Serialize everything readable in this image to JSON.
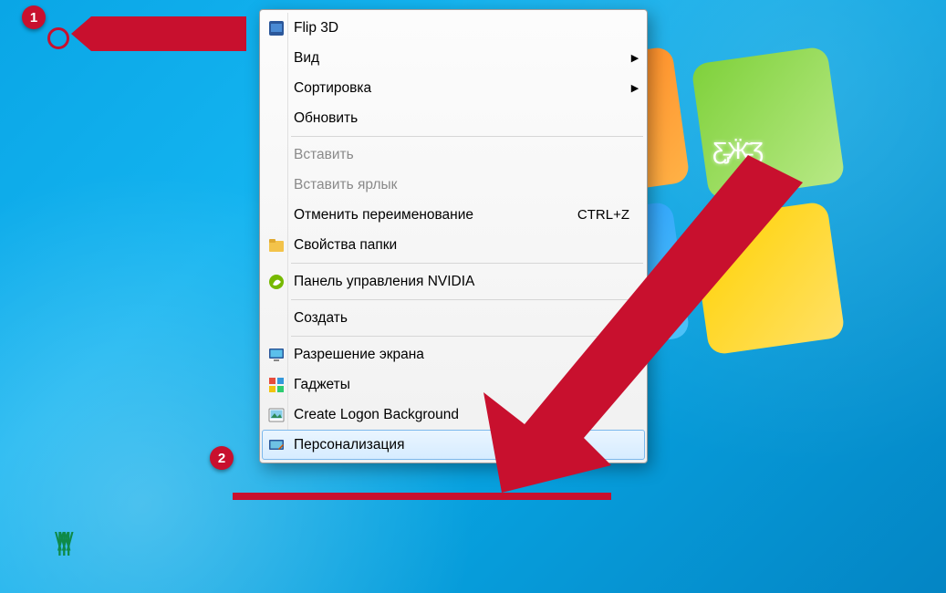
{
  "annotations": {
    "step1": "1",
    "step2": "2"
  },
  "menu": {
    "items": [
      {
        "id": "flip3d",
        "label": "Flip 3D",
        "icon": "flip3d-icon",
        "submenu": false
      },
      {
        "id": "view",
        "label": "Вид",
        "icon": null,
        "submenu": true
      },
      {
        "id": "sort",
        "label": "Сортировка",
        "icon": null,
        "submenu": true
      },
      {
        "id": "refresh",
        "label": "Обновить",
        "icon": null,
        "submenu": false
      },
      {
        "sep": true
      },
      {
        "id": "paste",
        "label": "Вставить",
        "icon": null,
        "disabled": true
      },
      {
        "id": "pastelnk",
        "label": "Вставить ярлык",
        "icon": null,
        "disabled": true
      },
      {
        "id": "undo",
        "label": "Отменить переименование",
        "icon": null,
        "shortcut": "CTRL+Z"
      },
      {
        "id": "folderopt",
        "label": "Свойства папки",
        "icon": "folder-options-icon"
      },
      {
        "sep": true
      },
      {
        "id": "nvidia",
        "label": "Панель управления NVIDIA",
        "icon": "nvidia-icon"
      },
      {
        "sep": true
      },
      {
        "id": "new",
        "label": "Создать",
        "icon": null,
        "submenu": true
      },
      {
        "sep": true
      },
      {
        "id": "screenres",
        "label": "Разрешение экрана",
        "icon": "monitor-icon"
      },
      {
        "id": "gadgets",
        "label": "Гаджеты",
        "icon": "gadgets-icon"
      },
      {
        "id": "logonbg",
        "label": "Create Logon Background",
        "icon": "picture-icon"
      },
      {
        "id": "personal",
        "label": "Персонализация",
        "icon": "personalize-icon",
        "hovered": true
      }
    ]
  }
}
